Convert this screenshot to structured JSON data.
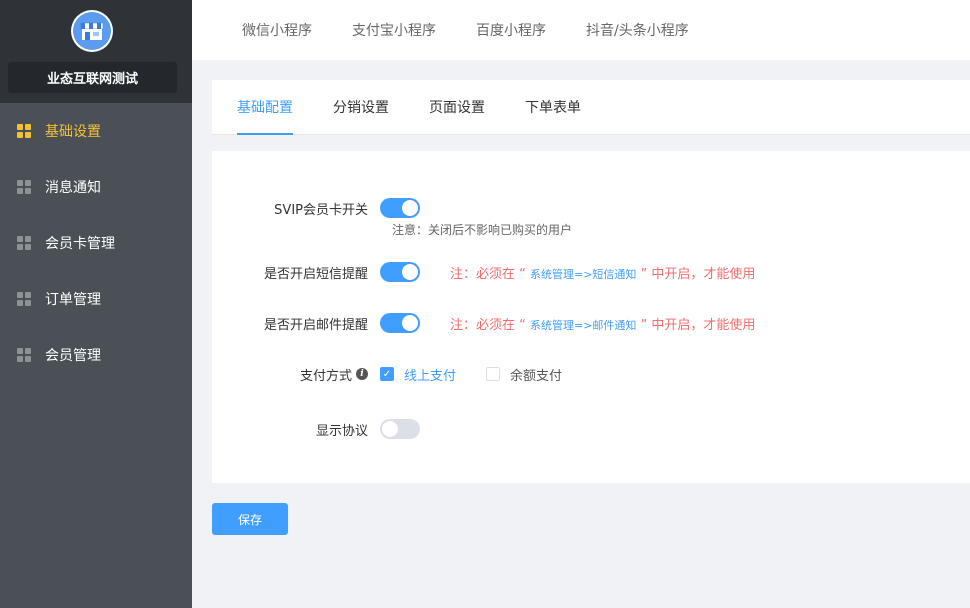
{
  "sidebar": {
    "shop_name": "业态互联网测试",
    "items": [
      {
        "label": "基础设置",
        "active": true
      },
      {
        "label": "消息通知",
        "active": false
      },
      {
        "label": "会员卡管理",
        "active": false
      },
      {
        "label": "订单管理",
        "active": false
      },
      {
        "label": "会员管理",
        "active": false
      }
    ]
  },
  "topbar": {
    "tabs": [
      "微信小程序",
      "支付宝小程序",
      "百度小程序",
      "抖音/头条小程序"
    ]
  },
  "tabs": {
    "items": [
      "基础配置",
      "分销设置",
      "页面设置",
      "下单表单"
    ],
    "active_index": 0
  },
  "form": {
    "svip": {
      "label": "SVIP会员卡开关",
      "enabled": true,
      "note": "注意：关闭后不影响已购买的用户"
    },
    "sms": {
      "label": "是否开启短信提醒",
      "enabled": true,
      "warn_prefix": "注：必须在 “ ",
      "warn_link": "系统管理=>短信通知",
      "warn_suffix": " ” 中开启，才能使用"
    },
    "email": {
      "label": "是否开启邮件提醒",
      "enabled": true,
      "warn_prefix": "注：必须在 “ ",
      "warn_link": "系统管理=>邮件通知",
      "warn_suffix": " ” 中开启，才能使用"
    },
    "payment": {
      "label": "支付方式",
      "options": [
        {
          "label": "线上支付",
          "checked": true
        },
        {
          "label": "余额支付",
          "checked": false
        }
      ]
    },
    "agreement": {
      "label": "显示协议",
      "enabled": false
    }
  },
  "save_label": "保存",
  "colors": {
    "accent": "#409eff",
    "active_nav": "#f5c133",
    "warning": "#f56c6c",
    "sidebar": "#4a5055"
  }
}
